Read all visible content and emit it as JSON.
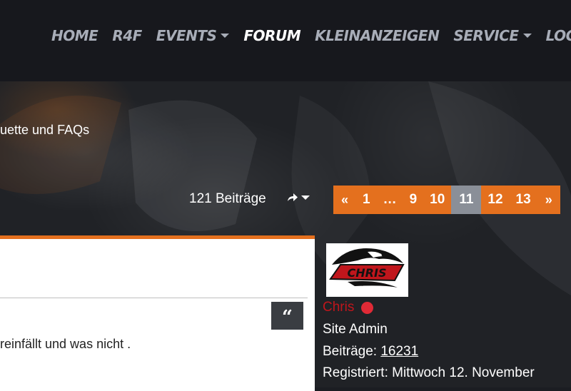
{
  "nav": {
    "items": [
      {
        "label": "HOME"
      },
      {
        "label": "R4F"
      },
      {
        "label": "EVENTS"
      },
      {
        "label": "FORUM"
      },
      {
        "label": "KLEINANZEIGEN"
      },
      {
        "label": "SERVICE"
      },
      {
        "label": "LOGIN"
      }
    ]
  },
  "breadcrumb": {
    "text": "uette und FAQs"
  },
  "topic": {
    "post_count": "121 Beiträge",
    "share_icon": "share-icon"
  },
  "pagination": {
    "first": "«",
    "pages": [
      "1",
      "…",
      "9",
      "10",
      "11",
      "12",
      "13"
    ],
    "current": "11",
    "last": "»",
    "accent": "#e4701e"
  },
  "post": {
    "text": "reinfällt und was nicht .",
    "quote_icon": "quote-icon"
  },
  "author": {
    "avatar_text": "CHRIS",
    "name": "Chris",
    "rank": "Site Admin",
    "posts_label": "Beiträge:",
    "posts_value": "16231",
    "registered": "Registriert: Mittwoch 12. November"
  }
}
